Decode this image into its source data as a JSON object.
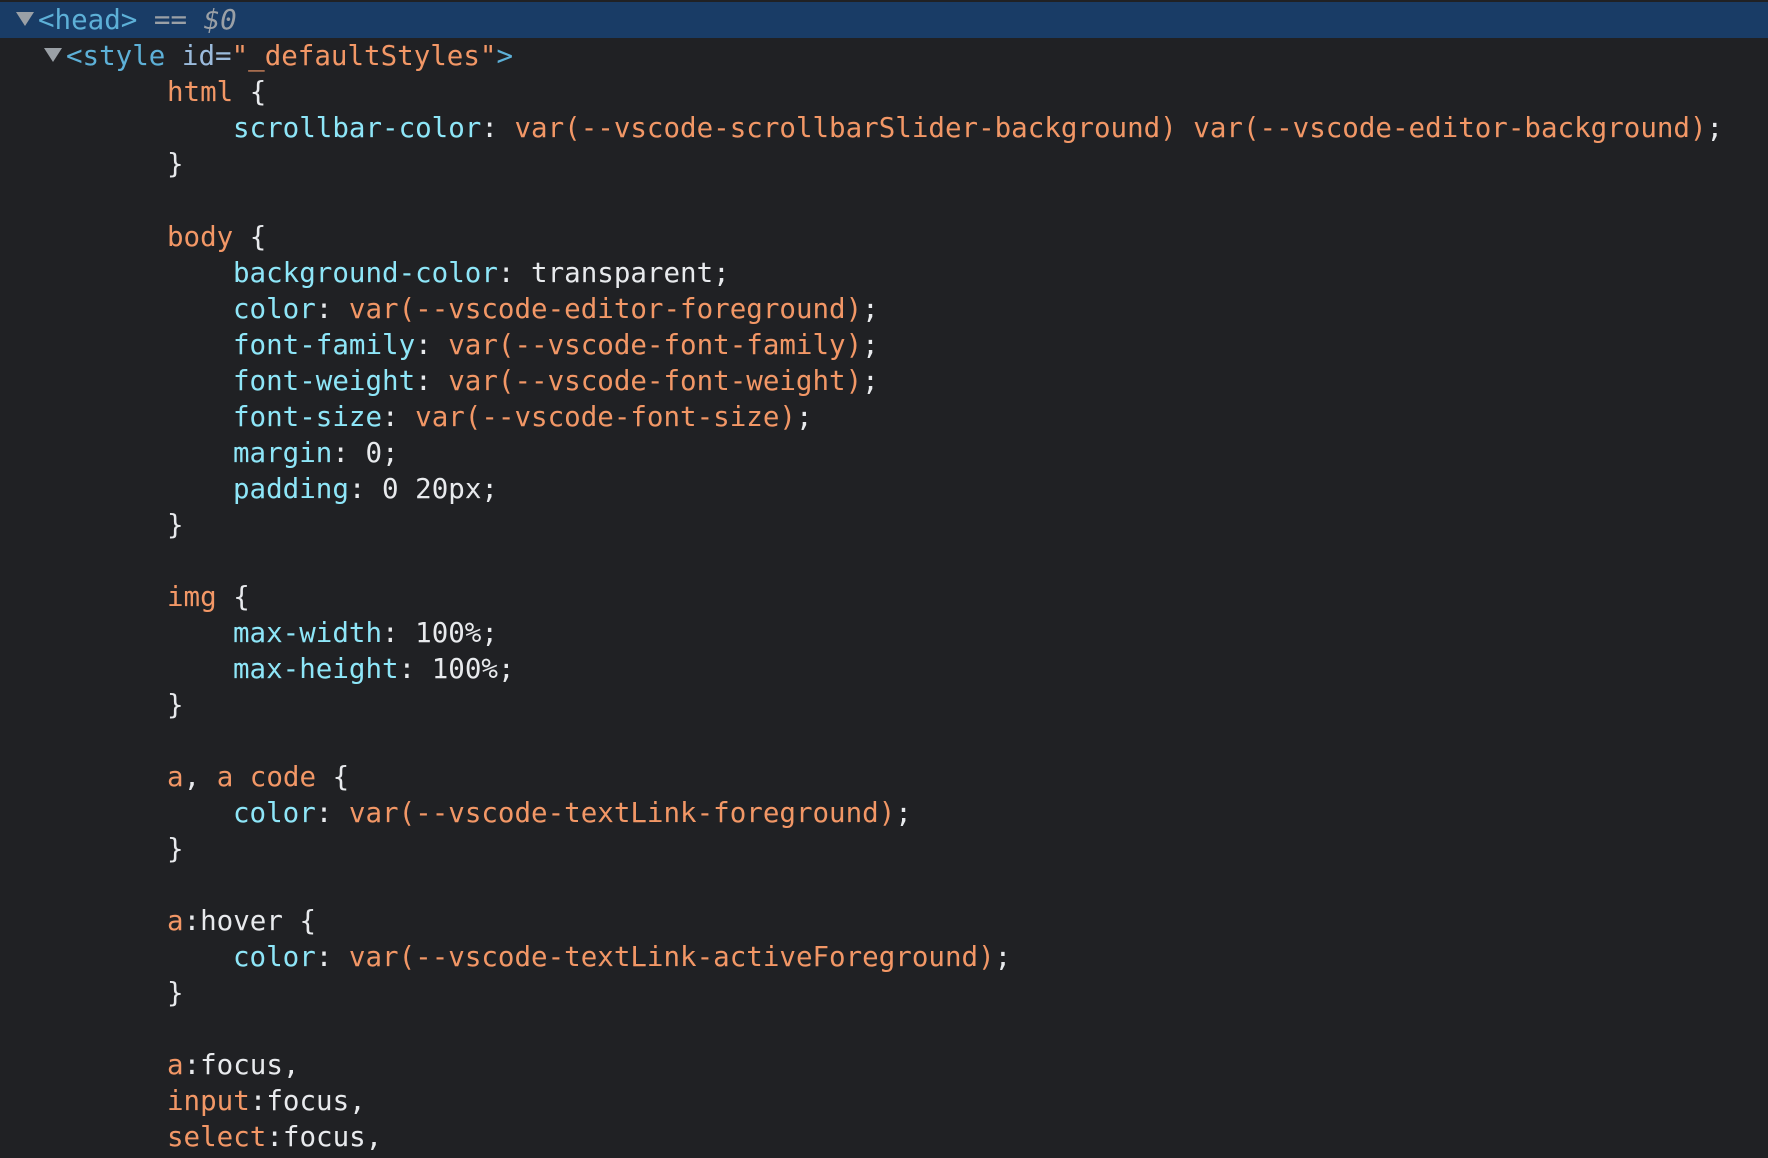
{
  "head_line": {
    "tag": "<head>",
    "separator": " == ",
    "console_ref": "$0"
  },
  "style_open": {
    "tag_start": "<style",
    "attr_name": " id=",
    "attr_value": "\"_defaultStyles\"",
    "tag_end": ">"
  },
  "rules": {
    "html": {
      "selector": "html",
      "decls": [
        {
          "prop": "scrollbar-color",
          "value": "var(--vscode-scrollbarSlider-background) var(--vscode-editor-background)"
        }
      ]
    },
    "body": {
      "selector": "body",
      "decls": [
        {
          "prop": "background-color",
          "value": "transparent"
        },
        {
          "prop": "color",
          "value": "var(--vscode-editor-foreground)"
        },
        {
          "prop": "font-family",
          "value": "var(--vscode-font-family)"
        },
        {
          "prop": "font-weight",
          "value": "var(--vscode-font-weight)"
        },
        {
          "prop": "font-size",
          "value": "var(--vscode-font-size)"
        },
        {
          "prop": "margin",
          "value": "0"
        },
        {
          "prop": "padding",
          "value": "0 20px"
        }
      ]
    },
    "img": {
      "selector": "img",
      "decls": [
        {
          "prop": "max-width",
          "value": "100%"
        },
        {
          "prop": "max-height",
          "value": "100%"
        }
      ]
    },
    "a_code": {
      "selector_a": "a",
      "selector_sep": ", ",
      "selector_b": "a code",
      "decls": [
        {
          "prop": "color",
          "value": "var(--vscode-textLink-foreground)"
        }
      ]
    },
    "a_hover": {
      "selector": "a",
      "pseudo": ":hover",
      "decls": [
        {
          "prop": "color",
          "value": "var(--vscode-textLink-activeForeground)"
        }
      ]
    },
    "focus_group": {
      "items": [
        {
          "selector": "a",
          "pseudo": ":focus,"
        },
        {
          "selector": "input",
          "pseudo": ":focus,"
        },
        {
          "selector": "select",
          "pseudo": ":focus,"
        }
      ]
    }
  },
  "punctuation": {
    "open_brace": " {",
    "close_brace": "}",
    "colon": ": ",
    "semicolon": ";"
  }
}
